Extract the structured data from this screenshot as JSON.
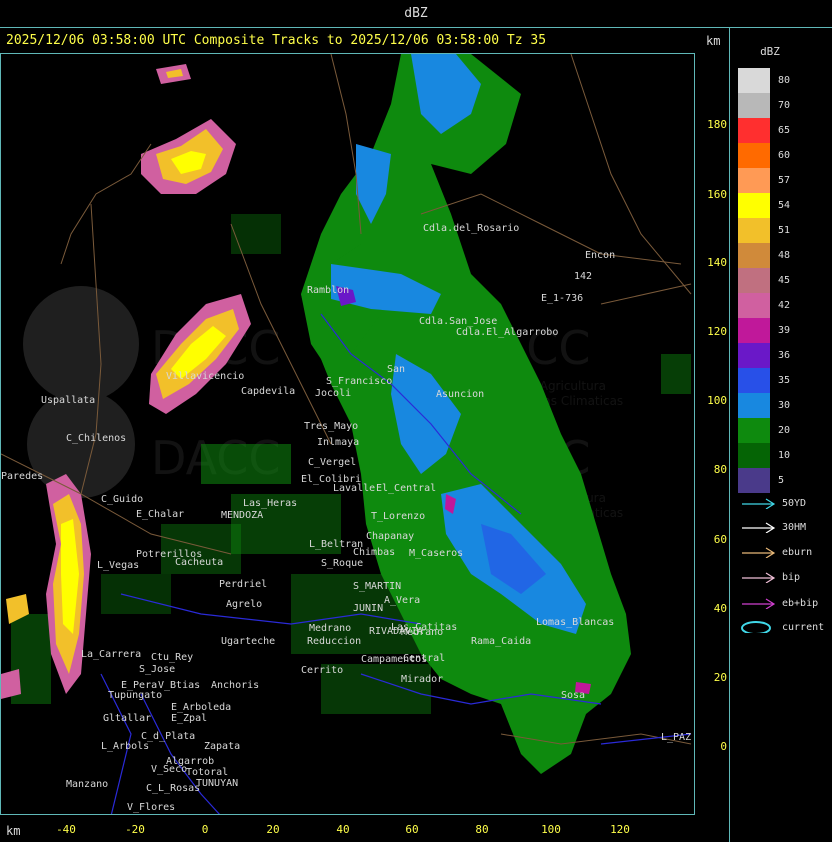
{
  "header": {
    "title": "dBZ"
  },
  "subtitle": "2025/12/06 03:58:00 UTC Composite Tracks to 2025/12/06 03:58:00 Tz 35",
  "axes": {
    "unit_label": "km",
    "y_ticks": [
      "180",
      "160",
      "140",
      "120",
      "100",
      "80",
      "60",
      "40",
      "20",
      "0"
    ],
    "x_ticks": [
      "-40",
      "-20",
      "0",
      "20",
      "40",
      "60",
      "80",
      "100",
      "120"
    ]
  },
  "legend": {
    "title": "dBZ",
    "items": [
      {
        "label": "80",
        "color": "#d9d9d9"
      },
      {
        "label": "70",
        "color": "#b8b8b8"
      },
      {
        "label": "65",
        "color": "#ff2f2f"
      },
      {
        "label": "60",
        "color": "#ff6a00"
      },
      {
        "label": "57",
        "color": "#ff9a55"
      },
      {
        "label": "54",
        "color": "#ffff00"
      },
      {
        "label": "51",
        "color": "#f2c02a"
      },
      {
        "label": "48",
        "color": "#d08a3a"
      },
      {
        "label": "45",
        "color": "#c07080"
      },
      {
        "label": "42",
        "color": "#d060a0"
      },
      {
        "label": "39",
        "color": "#c0189a"
      },
      {
        "label": "36",
        "color": "#6a18c8"
      },
      {
        "label": "35",
        "color": "#2850e8"
      },
      {
        "label": "30",
        "color": "#1888e0"
      },
      {
        "label": "20",
        "color": "#0e8a0e"
      },
      {
        "label": "10",
        "color": "#056405"
      },
      {
        "label": "5",
        "color": "#4a3a8a"
      }
    ]
  },
  "tracks": [
    {
      "label": "50YD",
      "color": "#40d8e8"
    },
    {
      "label": "30HM",
      "color": "#ffffff"
    },
    {
      "label": "eburn",
      "color": "#e8b878"
    },
    {
      "label": "bip",
      "color": "#f0c0d8"
    },
    {
      "label": "eb+bip",
      "color": "#d040d0"
    },
    {
      "label": "current",
      "color": "#40d8e8"
    }
  ],
  "watermark": {
    "name": "DACC",
    "line1": "Direccion de Agricultura",
    "line2": "y Contingencias Climaticas"
  },
  "places": [
    "Cdla.del_Rosario",
    "Encon",
    "142",
    "E_1-736",
    "Ramblon",
    "Cdla.San_Jose",
    "Cdla.El_Algarrobo",
    "Uspallata",
    "Villavicencio",
    "Capdevila",
    "S_Francisco",
    "Jocoli",
    "San",
    "Asuncion",
    "C_Chilenos",
    "Tres_Mayo",
    "Inlmaya",
    "Paredes",
    "C_Vergel",
    "El_Colibri",
    "Lavalle",
    "El_Central",
    "C_Guido",
    "E_Chalar",
    "MENDOZA",
    "Las_Heras",
    "T_Lorenzo",
    "L_Beltran",
    "Chimbas",
    "Medrano",
    "M_Caseros",
    "Potrerillos",
    "Cacheuta",
    "L_Vegas",
    "Perdriel",
    "Agrelo",
    "S_Roque",
    "Chapanay",
    "S_MARTIN",
    "A_Vera",
    "JUNIN",
    "Medrano",
    "Reduccion",
    "RIVADAVIA",
    "Las_Catitas",
    "Rama_Caida",
    "La_Carrera",
    "Ctu_Rey",
    "S_Jose",
    "Ugarteche",
    "Anchoris",
    "Cerrito",
    "Campamentos",
    "Central",
    "Mirador",
    "Lomas_Blancas",
    "Sosa",
    "Tupungato",
    "E_Pera",
    "V_Btias",
    "E_Arboleda",
    "Gltallar",
    "E_Zpal",
    "L_Arbols",
    "C_d_Plata",
    "Zapata",
    "Algarrob",
    "V_Seco",
    "Totoral",
    "TUNUYAN",
    "Manzano",
    "C_L_Rosas",
    "V_Flores",
    "L_PAZ"
  ]
}
